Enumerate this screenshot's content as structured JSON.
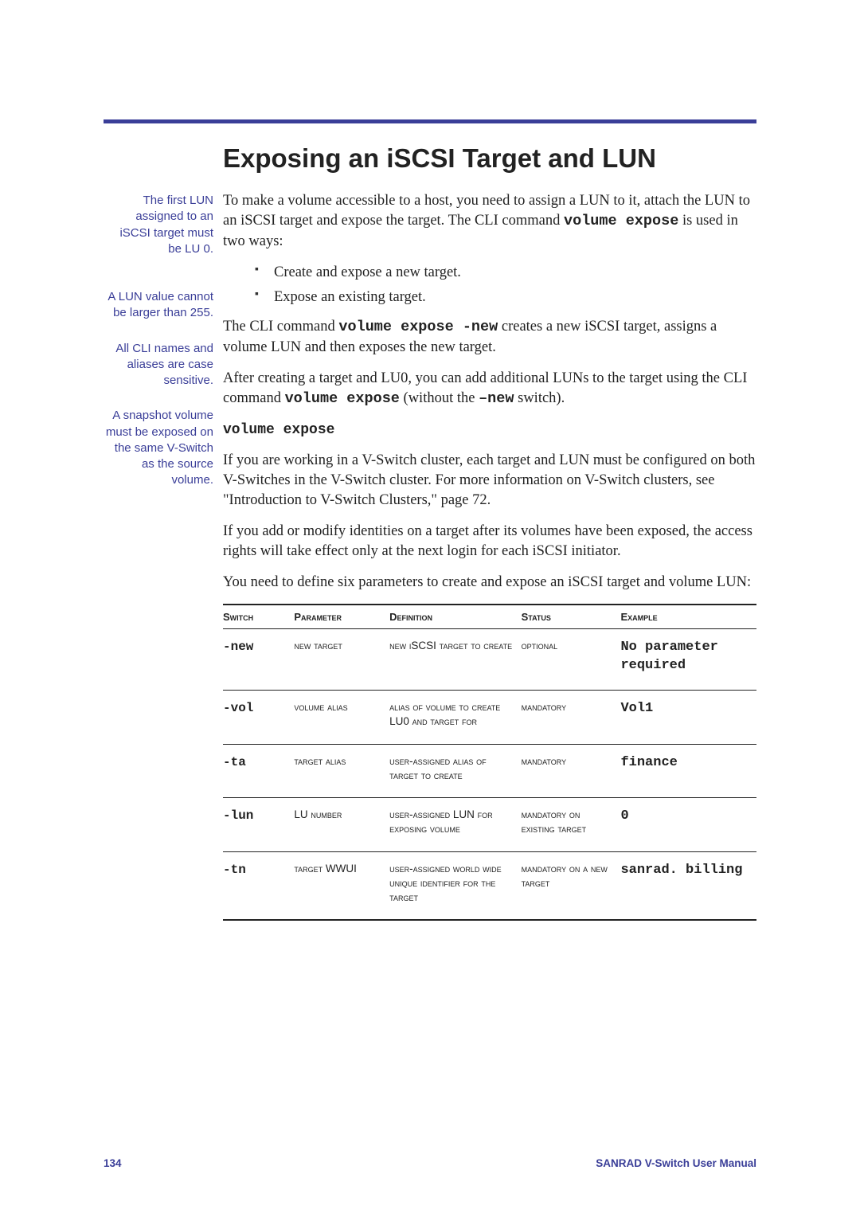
{
  "title": "Exposing an iSCSI Target and LUN",
  "side_notes": {
    "n1": "The first LUN assigned to an iSCSI target must be LU 0.",
    "n2": "A LUN value cannot be larger than 255.",
    "n3": "All CLI names and aliases are case sensitive.",
    "n4": "A snapshot volume must be exposed on the same V-Switch as the source volume."
  },
  "body": {
    "p1a": "To make a volume accessible to a host, you need to assign a LUN to it, attach the LUN to an iSCSI target and expose the target.  The CLI command ",
    "p1cmd": "volume expose",
    "p1b": " is used in two ways:",
    "b1": "Create and expose a new target.",
    "b2": "Expose an existing target.",
    "p2a": "The CLI command ",
    "p2cmd": "volume expose -new",
    "p2b": " creates a new iSCSI target, assigns a volume LUN and then exposes the new target.",
    "p3a": "After creating a target and LU0, you can add additional LUNs to the target using the CLI command ",
    "p3cmd": "volume expose",
    "p3b": "  (without the ",
    "p3cmd2": "–new",
    "p3c": " switch).",
    "cmd_heading": "volume expose",
    "p4": "If you are working in a V-Switch cluster, each target and LUN must be configured on both V-Switches in the V-Switch cluster.  For more information on V-Switch clusters, see \"Introduction to V-Switch Clusters,\" page 72.",
    "p5": "If you add or modify identities on a target after its volumes have been exposed, the access rights will take effect only at the next login for each iSCSI initiator.",
    "p6": "You need to define six parameters to create and expose an iSCSI target and volume LUN:"
  },
  "table": {
    "headers": {
      "switch": "Switch",
      "parameter": "Parameter",
      "definition": "Definition",
      "status": "Status",
      "example": "Example"
    },
    "rows": [
      {
        "switch": "-new",
        "parameter": "new target",
        "definition": "new iSCSI target to create",
        "status": "optional",
        "example": "No parameter required"
      },
      {
        "switch": "-vol",
        "parameter": "volume alias",
        "definition": "alias of volume to create LU0 and target for",
        "status": "mandatory",
        "example": "Vol1"
      },
      {
        "switch": "-ta",
        "parameter": "target alias",
        "definition": "user-assigned alias of target to create",
        "status": "mandatory",
        "example": "finance"
      },
      {
        "switch": "-lun",
        "parameter": "LU number",
        "definition": "user-assigned LUN for exposing volume",
        "status": "mandatory on existing target",
        "example": "0"
      },
      {
        "switch": "-tn",
        "parameter": "target WWUI",
        "definition": "user-assigned world wide unique identifier for the target",
        "status": "mandatory on a new target",
        "example": "sanrad. billing"
      }
    ]
  },
  "footer": {
    "page": "134",
    "manual": "SANRAD V-Switch  User Manual"
  }
}
